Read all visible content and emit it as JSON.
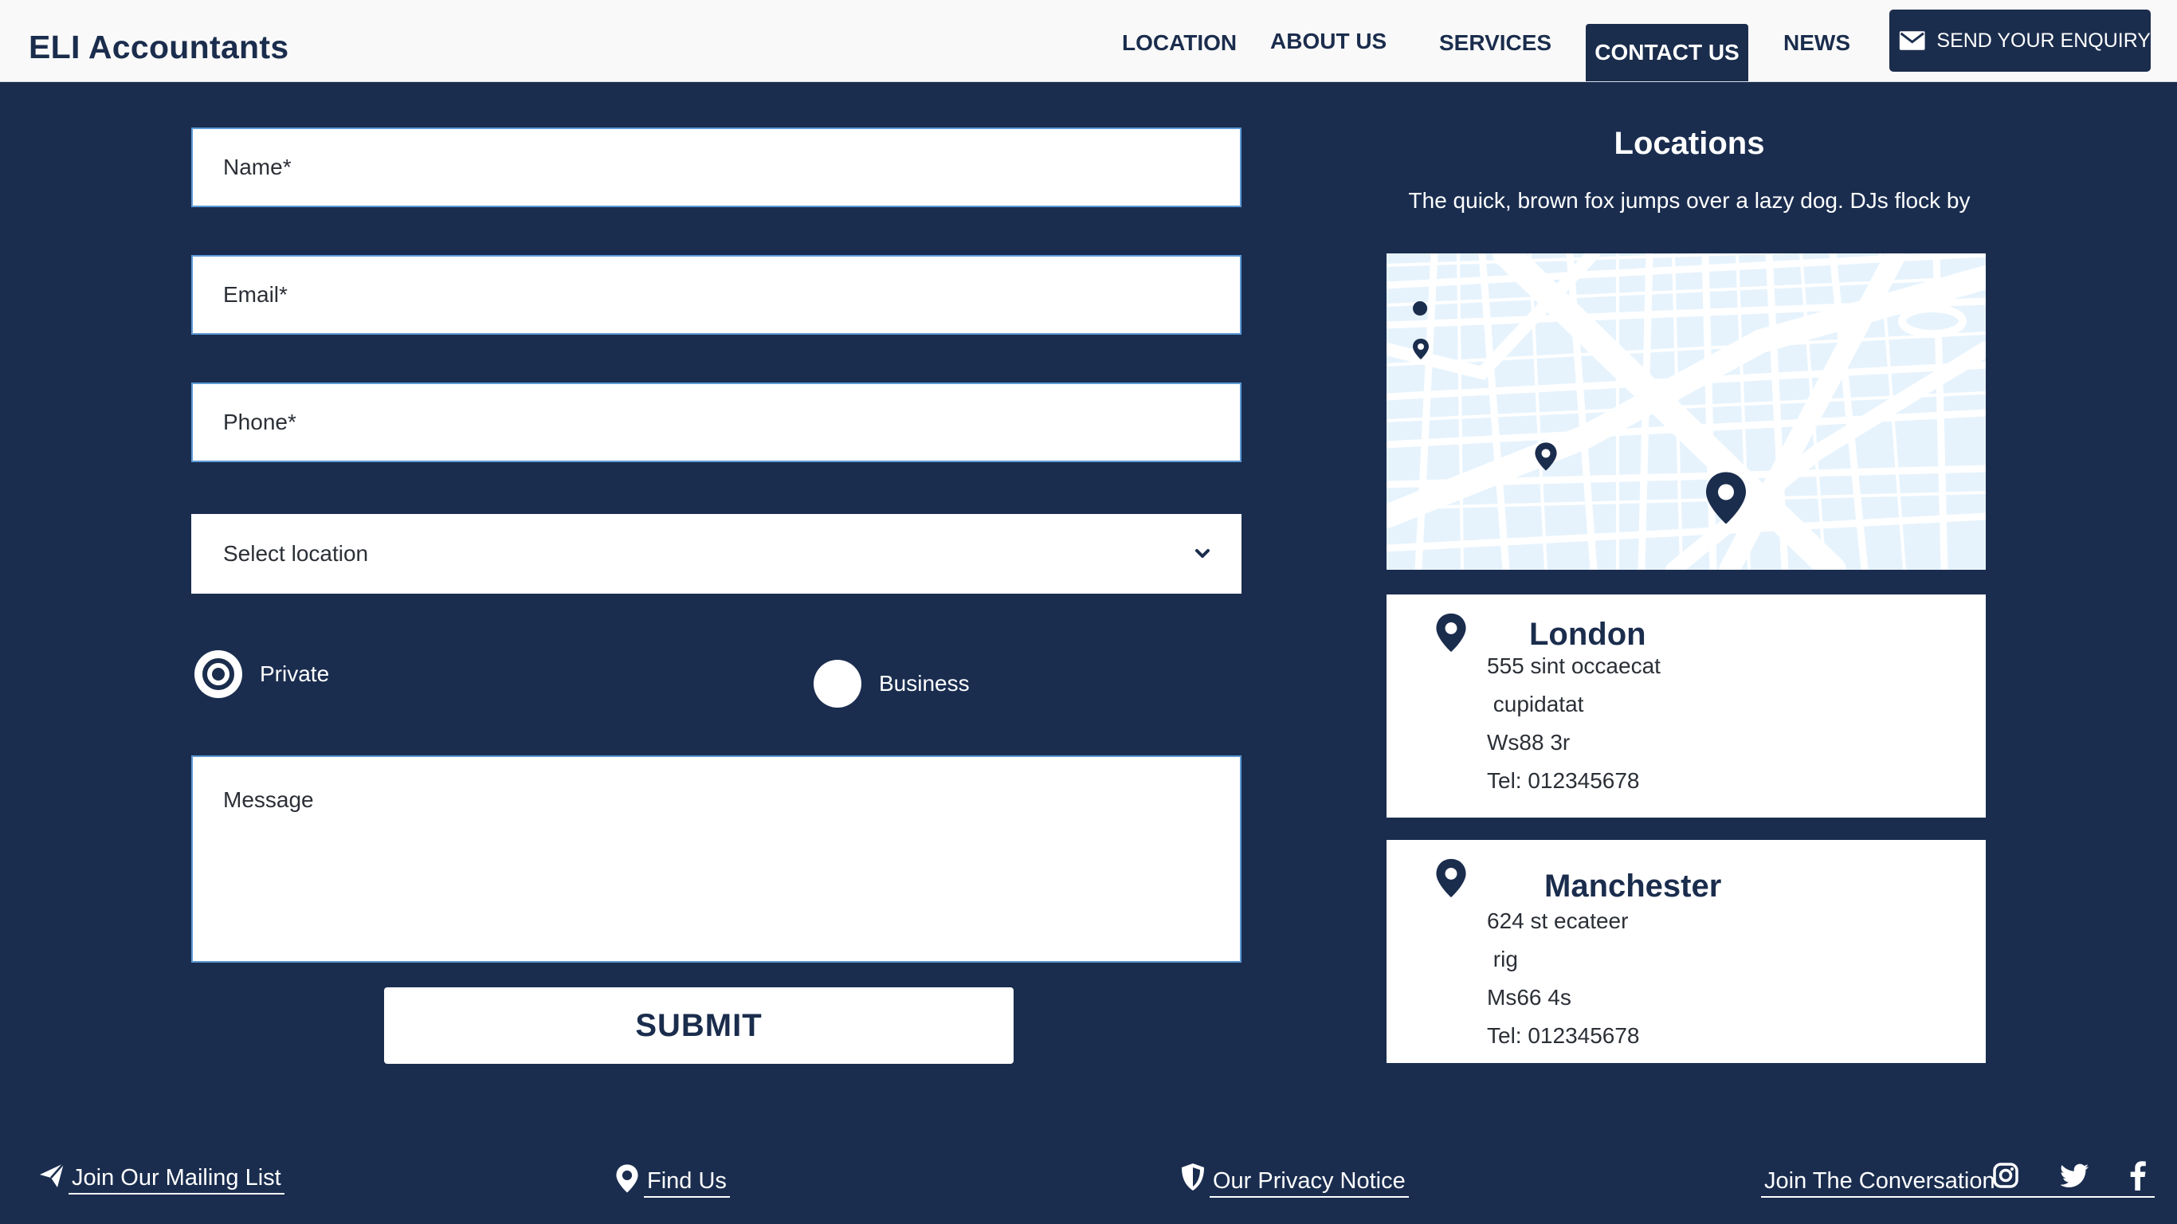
{
  "header": {
    "brand": "ELI Accountants",
    "nav": {
      "location": "LOCATION",
      "about": "ABOUT US",
      "services": "SERVICES",
      "contact": "CONTACT US",
      "news": "NEWS"
    },
    "enquiry_label": "SEND YOUR ENQUIRY"
  },
  "form": {
    "name_placeholder": "Name*",
    "email_placeholder": "Email*",
    "phone_placeholder": "Phone*",
    "location_select": "Select location",
    "radio": {
      "private_label": "Private",
      "business_label": "Business",
      "selected": "Private"
    },
    "message_placeholder": "Message",
    "submit_label": "SUBMIT"
  },
  "locations": {
    "title": "Locations",
    "subtitle": "The quick, brown fox jumps over a lazy dog. DJs flock by",
    "offices": [
      {
        "city": "London",
        "address1": "555 sint occaecat",
        "address2": " cupidatat",
        "postcode": "Ws88 3r",
        "tel": "Tel: 012345678"
      },
      {
        "city": "Manchester",
        "address1": "624 st ecateer",
        "address2": " rig",
        "postcode": "Ms66 4s",
        "tel": "Tel: 012345678"
      }
    ]
  },
  "footer": {
    "mailing": "Join Our Mailing List",
    "find_us": "Find Us",
    "privacy": "Our Privacy Notice",
    "conversation": "Join The Conversation"
  },
  "colors": {
    "navy": "#1a2d4f",
    "header_bg": "#f9f9f9",
    "field_border": "#5c9ad6",
    "map_bg": "#e6f3fd"
  },
  "icons": [
    "envelope-icon",
    "chevron-down-icon",
    "map-pin-icon",
    "paper-plane-icon",
    "shield-icon",
    "instagram-icon",
    "twitter-icon",
    "facebook-icon"
  ]
}
